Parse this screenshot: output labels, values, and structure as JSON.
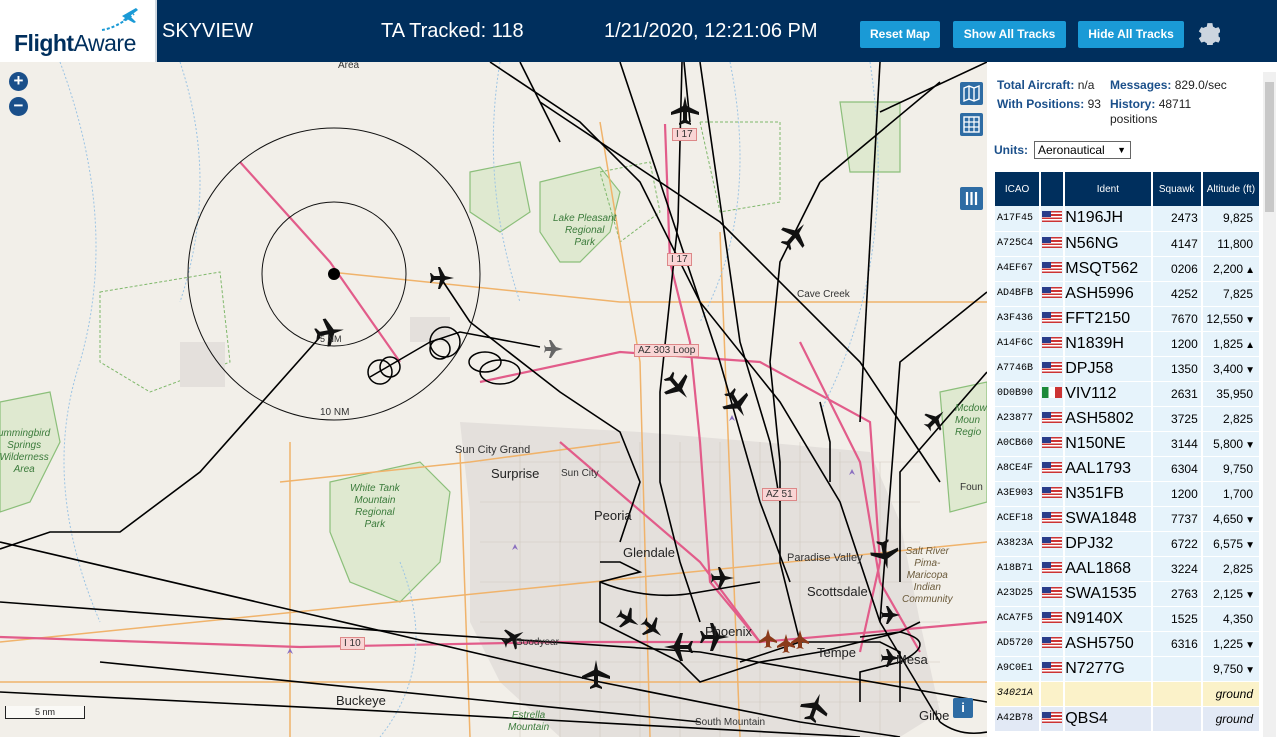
{
  "header": {
    "logo_text": "FlightAware",
    "title": "SKYVIEW",
    "ta_tracked": "TA Tracked: 118",
    "datetime": "1/21/2020, 12:21:06 PM",
    "reset_map": "Reset Map",
    "show_all": "Show All Tracks",
    "hide_all": "Hide All Tracks"
  },
  "map": {
    "zoom_in": "+",
    "zoom_out": "−",
    "scale": "5 nm",
    "info": "i",
    "range_5": "5 NM",
    "range_10": "10 NM",
    "labels": {
      "area_top": "Area",
      "cave_creek": "Cave Creek",
      "sun_city_grand": "Sun City Grand",
      "surprise": "Surprise",
      "sun_city": "Sun City",
      "peoria": "Peoria",
      "glendale": "Glendale",
      "paradise_valley": "Paradise Valley",
      "scottsdale": "Scottsdale",
      "phoenix": "Phoenix",
      "tempe": "Tempe",
      "mesa": "Mesa",
      "buckeye": "Buckeye",
      "goodyear": "Goodyear",
      "gilbert": "Gilbe",
      "fountain": "Foun",
      "south_mountain": "South Mountain",
      "estrella": "Estrella\nMountain",
      "lake_pleasant": "Lake Pleasant\nRegional\nPark",
      "white_tank": "White Tank\nMountain\nRegional\nPark",
      "hummingbird": "ummingbird\nSprings\nWilderness\nArea",
      "mcdowell": "Mcdow\nMoun\nRegio",
      "salt_river": "Salt River\nPima-\nMaricopa\nIndian\nCommunity",
      "hwy_i17_top": "I 17",
      "hwy_i17_mid": "I 17",
      "hwy_303": "AZ 303 Loop",
      "hwy_51": "AZ 51",
      "hwy_i10": "I 10"
    }
  },
  "panel": {
    "total_aircraft_key": "Total Aircraft:",
    "total_aircraft_val": "n/a",
    "messages_key": "Messages:",
    "messages_val": "829.0/sec",
    "with_positions_key": "With Positions:",
    "with_positions_val": "93",
    "history_key": "History:",
    "history_val": "48711 positions",
    "units_label": "Units:",
    "units_value": "Aeronautical",
    "columns": [
      "ICAO",
      "",
      "Ident",
      "Squawk",
      "Altitude (ft)"
    ],
    "rows": [
      {
        "icao": "A17F45",
        "flag": "us",
        "ident": "N196JH",
        "squawk": "2473",
        "alt": "9,825",
        "trend": ""
      },
      {
        "icao": "A725C4",
        "flag": "us",
        "ident": "N56NG",
        "squawk": "4147",
        "alt": "11,800",
        "trend": ""
      },
      {
        "icao": "A4EF67",
        "flag": "us",
        "ident": "MSQT562",
        "squawk": "0206",
        "alt": "2,200",
        "trend": "▲"
      },
      {
        "icao": "AD4BFB",
        "flag": "us",
        "ident": "ASH5996",
        "squawk": "4252",
        "alt": "7,825",
        "trend": ""
      },
      {
        "icao": "A3F436",
        "flag": "us",
        "ident": "FFT2150",
        "squawk": "7670",
        "alt": "12,550",
        "trend": "▼"
      },
      {
        "icao": "A14F6C",
        "flag": "us",
        "ident": "N1839H",
        "squawk": "1200",
        "alt": "1,825",
        "trend": "▲"
      },
      {
        "icao": "A7746B",
        "flag": "us",
        "ident": "DPJ58",
        "squawk": "1350",
        "alt": "3,400",
        "trend": "▼"
      },
      {
        "icao": "0D0B90",
        "flag": "mx",
        "ident": "VIV112",
        "squawk": "2631",
        "alt": "35,950",
        "trend": ""
      },
      {
        "icao": "A23877",
        "flag": "us",
        "ident": "ASH5802",
        "squawk": "3725",
        "alt": "2,825",
        "trend": ""
      },
      {
        "icao": "A0CB60",
        "flag": "us",
        "ident": "N150NE",
        "squawk": "3144",
        "alt": "5,800",
        "trend": "▼"
      },
      {
        "icao": "A8CE4F",
        "flag": "us",
        "ident": "AAL1793",
        "squawk": "6304",
        "alt": "9,750",
        "trend": ""
      },
      {
        "icao": "A3E903",
        "flag": "us",
        "ident": "N351FB",
        "squawk": "1200",
        "alt": "1,700",
        "trend": ""
      },
      {
        "icao": "ACEF18",
        "flag": "us",
        "ident": "SWA1848",
        "squawk": "7737",
        "alt": "4,650",
        "trend": "▼"
      },
      {
        "icao": "A3823A",
        "flag": "us",
        "ident": "DPJ32",
        "squawk": "6722",
        "alt": "6,575",
        "trend": "▼"
      },
      {
        "icao": "A18B71",
        "flag": "us",
        "ident": "AAL1868",
        "squawk": "3224",
        "alt": "2,825",
        "trend": ""
      },
      {
        "icao": "A23D25",
        "flag": "us",
        "ident": "SWA1535",
        "squawk": "2763",
        "alt": "2,125",
        "trend": "▼"
      },
      {
        "icao": "ACA7F5",
        "flag": "us",
        "ident": "N9140X",
        "squawk": "1525",
        "alt": "4,350",
        "trend": ""
      },
      {
        "icao": "AD5720",
        "flag": "us",
        "ident": "ASH5750",
        "squawk": "6316",
        "alt": "1,225",
        "trend": "▼"
      },
      {
        "icao": "A9C0E1",
        "flag": "us",
        "ident": "N7277G",
        "squawk": "",
        "alt": "9,750",
        "trend": "▼"
      },
      {
        "icao": "34021A",
        "flag": "",
        "ident": "",
        "squawk": "",
        "alt": "ground",
        "trend": "",
        "style": "sel"
      },
      {
        "icao": "A42B78",
        "flag": "us",
        "ident": "QBS4",
        "squawk": "",
        "alt": "ground",
        "trend": "",
        "style": "grnd"
      }
    ]
  },
  "colors": {
    "header_bg": "#002f5d",
    "button_bg": "#1a9ad6",
    "row_bg": "#e6f3fb"
  }
}
